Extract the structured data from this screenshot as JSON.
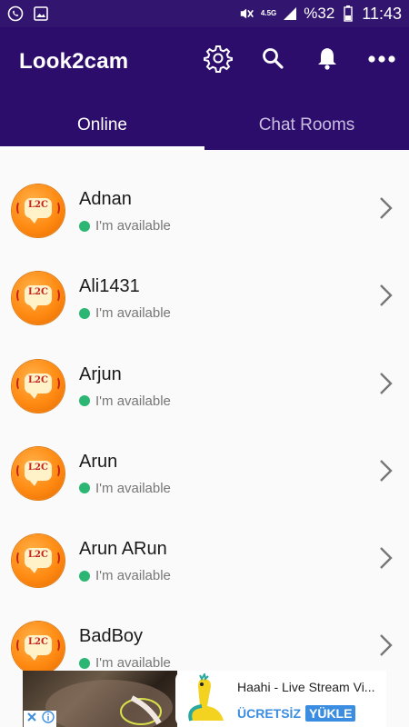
{
  "status_bar": {
    "battery_percent": "%32",
    "time": "11:43",
    "network": "4.5G",
    "icons": [
      "whatsapp-icon",
      "image-icon",
      "mute-icon",
      "network-icon",
      "signal-icon",
      "battery-icon"
    ]
  },
  "app_bar": {
    "title": "Look2cam",
    "actions": [
      "gear-icon",
      "search-icon",
      "bell-icon",
      "more-icon"
    ]
  },
  "tabs": [
    {
      "label": "Online",
      "active": true
    },
    {
      "label": "Chat Rooms",
      "active": false
    }
  ],
  "users": [
    {
      "name": "Adnan",
      "status": "I'm available"
    },
    {
      "name": "Ali1431",
      "status": "I'm available"
    },
    {
      "name": "Arjun",
      "status": "I'm available"
    },
    {
      "name": "Arun",
      "status": "I'm available"
    },
    {
      "name": "Arun ARun",
      "status": "I'm available"
    },
    {
      "name": "BadBoy",
      "status": "I'm available"
    }
  ],
  "ad": {
    "title": "Haahi - Live Stream Vi...",
    "cta_prefix": "ÜCRETSİZ",
    "cta_button": "YÜKLE"
  },
  "colors": {
    "status_bar": "#32156e",
    "app_bar": "#2c0d6b",
    "online_dot": "#2bb673",
    "ad_accent": "#3a8de0"
  }
}
